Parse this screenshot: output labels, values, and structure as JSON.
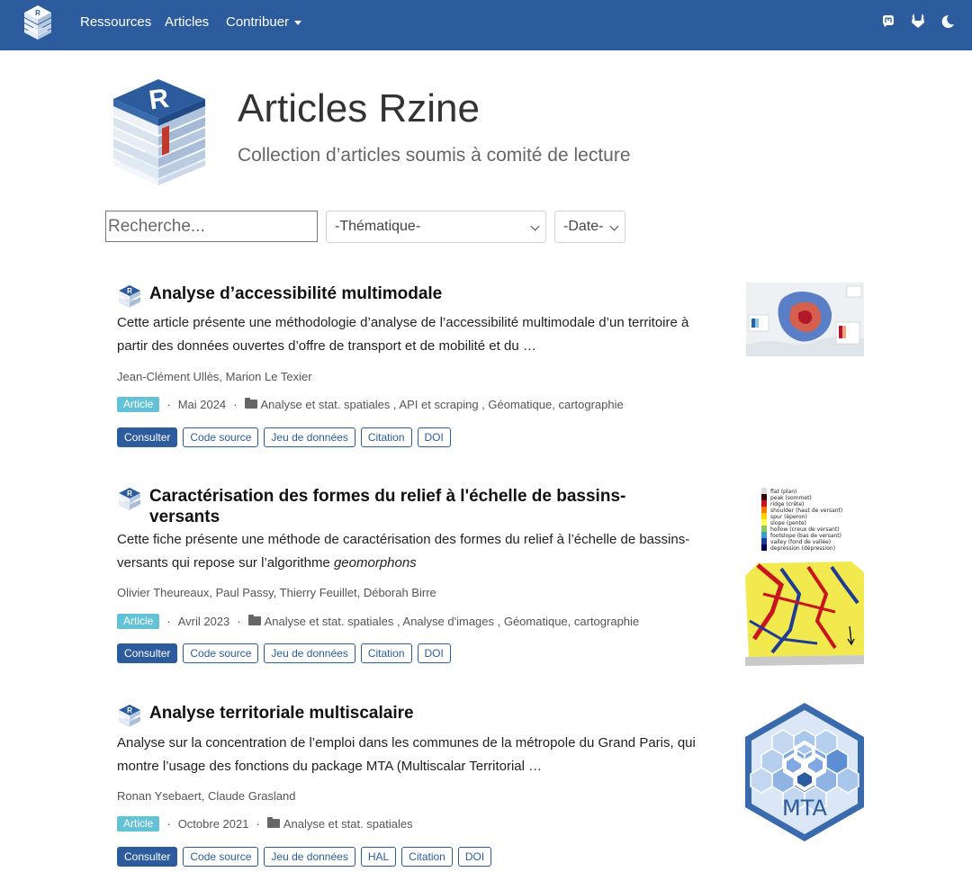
{
  "navbar": {
    "links": [
      "Ressources",
      "Articles",
      "Contribuer"
    ],
    "icons": [
      "mastodon-icon",
      "gitlab-icon",
      "moon-icon"
    ]
  },
  "header": {
    "title": "Articles Rzine",
    "subtitle": "Collection d’articles soumis à comité de lecture"
  },
  "filters": {
    "search_placeholder": "Recherche...",
    "thematique": "-Thématique-",
    "date": "-Date-"
  },
  "articles": [
    {
      "title": "Analyse d’accessibilité multimodale",
      "description": "Cette article présente une méthodologie d’analyse de l’accessibilité multimodale d’un territoire à partir des données ouvertes d’offre de transport et de mobilité et du …",
      "authors": "Jean-Clément Ullès, Marion Le Texier",
      "badge": "Article",
      "date": "Mai 2024",
      "tags": "Analyse et stat. spatiales , API et scraping , Géomatique, cartographie",
      "buttons": [
        "Consulter",
        "Code source",
        "Jeu de données",
        "Citation",
        "DOI"
      ]
    },
    {
      "title": "Caractérisation des formes du relief à l'échelle de bassins-versants",
      "description_before": "Cette fiche présente une méthode de caractérisation des formes du relief à l’échelle de bassins-versants qui repose sur l’algorithme ",
      "description_em": "geomorphons",
      "authors": "Olivier Theureaux, Paul Passy, Thierry Feuillet, Déborah Birre",
      "badge": "Article",
      "date": "Avril 2023",
      "tags": "Analyse et stat. spatiales , Analyse d'images , Géomatique, cartographie",
      "buttons": [
        "Consulter",
        "Code source",
        "Jeu de données",
        "Citation",
        "DOI"
      ],
      "legend": [
        "flat (plan)",
        "peak (sommet)",
        "ridge (crête)",
        "shoulder (haut de versant)",
        "spur (éperon)",
        "slope (pente)",
        "hollow (creux de versant)",
        "footslope (bas de versant)",
        "valley (fond de vallée)",
        "depression (dépression)"
      ]
    },
    {
      "title": "Analyse territoriale multiscalaire",
      "description": "Analyse sur la concentration de l’emploi dans les communes de la métropole du Grand Paris, qui montre l’usage des fonctions du package MTA (Multiscalar Territorial …",
      "authors": "Ronan Ysebaert, Claude Grasland",
      "badge": "Article",
      "date": "Octobre 2021",
      "tags": "Analyse et stat. spatiales",
      "buttons": [
        "Consulter",
        "Code source",
        "Jeu de données",
        "HAL",
        "Citation",
        "DOI"
      ],
      "logo_text": "MTA"
    }
  ],
  "colors": {
    "navbar": "#2c5c9e",
    "badge": "#63c2d6",
    "button": "#2c5c9e"
  }
}
